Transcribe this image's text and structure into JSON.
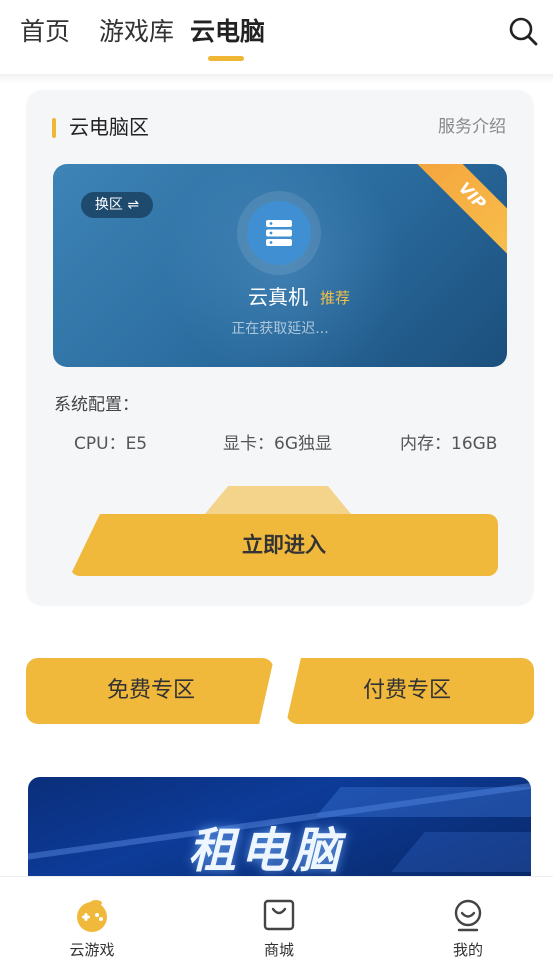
{
  "header": {
    "tabs": [
      {
        "label": "首页"
      },
      {
        "label": "游戏库"
      },
      {
        "label": "云电脑"
      }
    ],
    "active_tab": "云电脑"
  },
  "cloud_pc": {
    "section_title": "云电脑区",
    "service_link": "服务介绍",
    "banner": {
      "switch_label": "换区 ⇌",
      "vip_badge": "VIP",
      "machine_name": "云真机",
      "recommend_tag": "推荐",
      "latency_status": "正在获取延迟..."
    },
    "config_title": "系统配置：",
    "specs": [
      {
        "label": "CPU：E5"
      },
      {
        "label": "显卡：6G独显"
      },
      {
        "label": "内存：16GB"
      }
    ],
    "enter_button": "立即进入"
  },
  "zones": {
    "free_label": "免费专区",
    "paid_label": "付费专区"
  },
  "promo": {
    "text": "租电脑"
  },
  "bottom_nav": {
    "items": [
      {
        "label": "云游戏"
      },
      {
        "label": "商城"
      },
      {
        "label": "我的"
      }
    ]
  },
  "colors": {
    "accent": "#f0b93c",
    "banner_blue": "#2a6b9e",
    "recommend": "#f3c04c"
  }
}
